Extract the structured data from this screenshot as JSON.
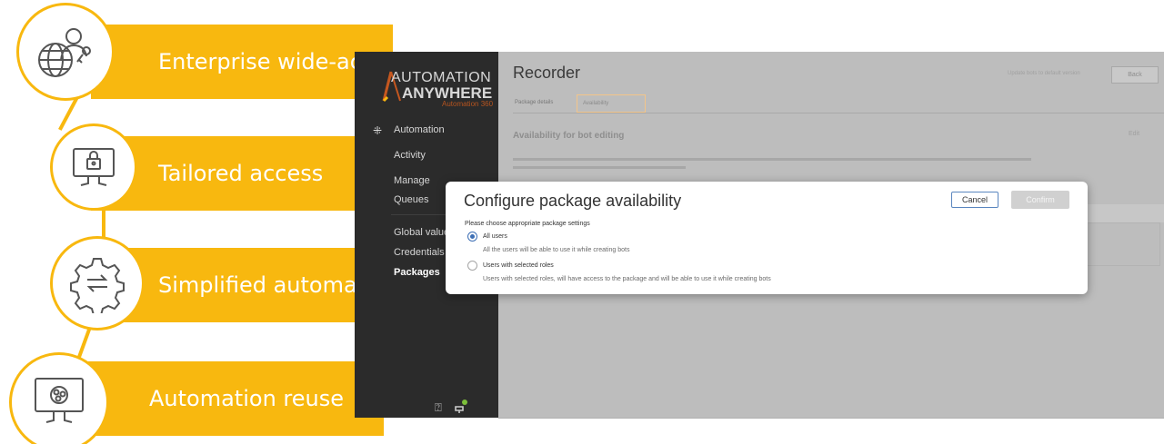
{
  "infographic": {
    "features": [
      {
        "label": "Enterprise wide-access policy",
        "icon": "globe-user-key-icon"
      },
      {
        "label": "Tailored access",
        "icon": "monitor-lock-icon"
      },
      {
        "label": "Simplified automation",
        "icon": "gear-sync-icon"
      },
      {
        "label": "Automation reuse",
        "icon": "monitor-reuse-icon"
      }
    ],
    "accent_color": "#f8b80f"
  },
  "sidebar": {
    "logo_line1": "AUTOMATION",
    "logo_line2": "ANYWHERE",
    "logo_line3": "Automation 360",
    "items": [
      {
        "label": "Automation"
      },
      {
        "label": "Activity"
      },
      {
        "label": "Manage"
      },
      {
        "label": "Queues"
      },
      {
        "label": "Global value"
      },
      {
        "label": "Credentials"
      },
      {
        "label": "Packages"
      }
    ],
    "active_item": "Packages"
  },
  "page": {
    "title": "Recorder",
    "tabs": [
      "Package details",
      "Availability"
    ],
    "selected_tab": "Availability",
    "section_title": "Availability for bot editing",
    "edit_label": "Edit",
    "update_link": "Update bots to default version",
    "back_label": "Back"
  },
  "dialog": {
    "title": "Configure package availability",
    "cancel_label": "Cancel",
    "confirm_label": "Confirm",
    "prompt": "Please choose appropriate package settings",
    "options": [
      {
        "label": "All users",
        "description": "All the users will be able to use it while creating bots",
        "checked": true
      },
      {
        "label": "Users with selected roles",
        "description": "Users with selected roles, will have access to the package and will be able to use it while creating bots",
        "checked": false
      }
    ]
  }
}
